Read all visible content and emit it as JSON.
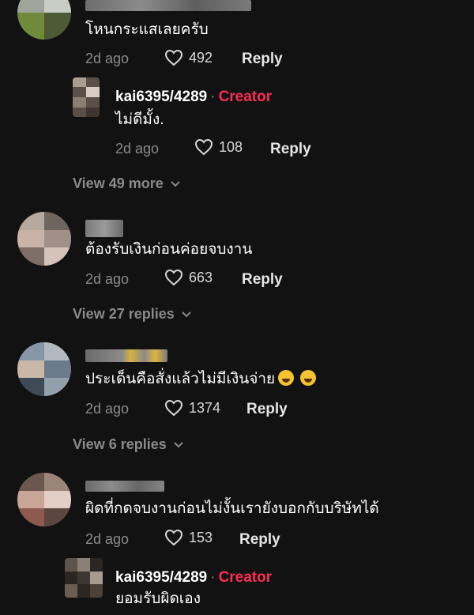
{
  "comments": [
    {
      "text": "โหนกระแสเลยครับ",
      "time": "2d ago",
      "likes": "492",
      "reply_label": "Reply",
      "replies": [
        {
          "author": "kai6395/4289",
          "separator": "·",
          "badge": "Creator",
          "text": "ไม่ดีมั้ง.",
          "time": "2d ago",
          "likes": "108",
          "reply_label": "Reply"
        }
      ],
      "view_more": "View 49 more"
    },
    {
      "text": "ต้องรับเงินก่อนค่อยจบงาน",
      "time": "2d ago",
      "likes": "663",
      "reply_label": "Reply",
      "view_more": "View 27 replies"
    },
    {
      "text": "ประเด็นคือสั่งแล้วไม่มีเงินจ่าย",
      "time": "2d ago",
      "likes": "1374",
      "reply_label": "Reply",
      "view_more": "View 6 replies"
    },
    {
      "text": "ผิดที่กดจบงานก่อนไม่งั้นเรายังบอกกับบริษัทได้",
      "time": "2d ago",
      "likes": "153",
      "reply_label": "Reply",
      "replies": [
        {
          "author": "kai6395/4289",
          "separator": "·",
          "badge": "Creator",
          "text": "ยอมรับผิดเอง"
        }
      ]
    }
  ],
  "icons": {
    "like": "heart-outline-icon",
    "expand": "chevron-down-icon",
    "emoji": "tears-of-joy-emoji"
  },
  "colors": {
    "background": "#121212",
    "creator": "#fe2c55",
    "muted": "#8a8a8a"
  }
}
